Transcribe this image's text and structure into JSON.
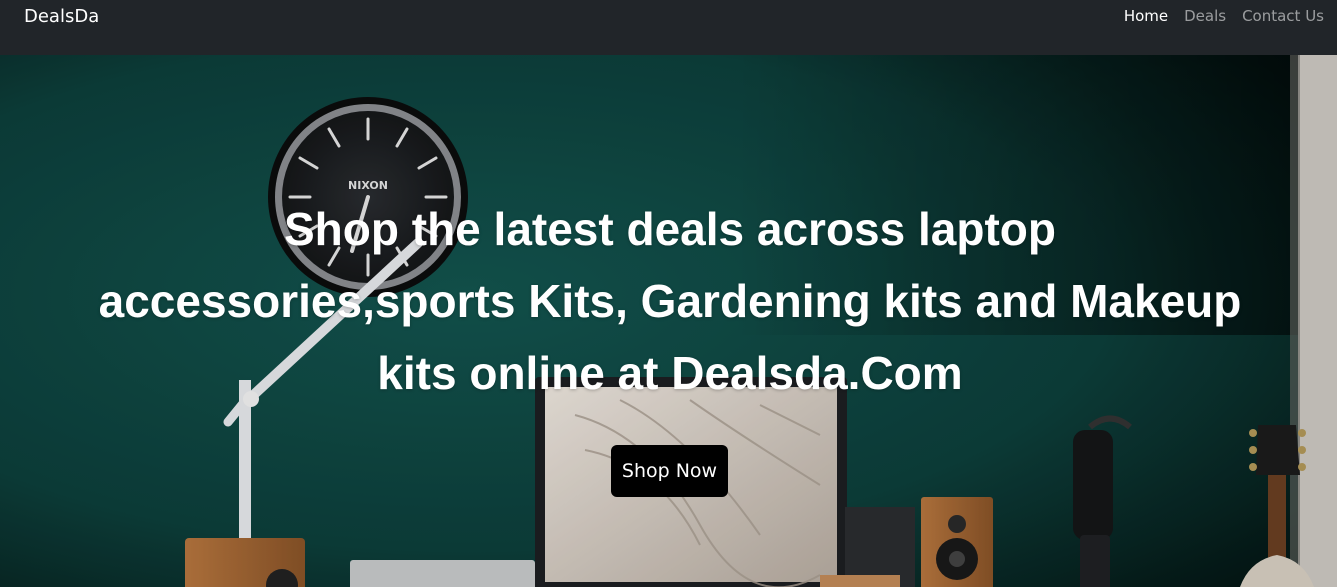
{
  "navbar": {
    "brand": "DealsDa",
    "links": [
      {
        "label": "Home",
        "active": true
      },
      {
        "label": "Deals",
        "active": false
      },
      {
        "label": "Contact Us",
        "active": false
      }
    ]
  },
  "hero": {
    "title": "Shop the latest deals across laptop accessories,sports Kits, Gardening kits and Makeup kits online at Dealsda.Com",
    "button_label": "Shop Now",
    "clock_brand": "NIXON"
  },
  "colors": {
    "navbar_bg": "#212529",
    "wall": "#0f4a45",
    "button_bg": "#000000"
  }
}
